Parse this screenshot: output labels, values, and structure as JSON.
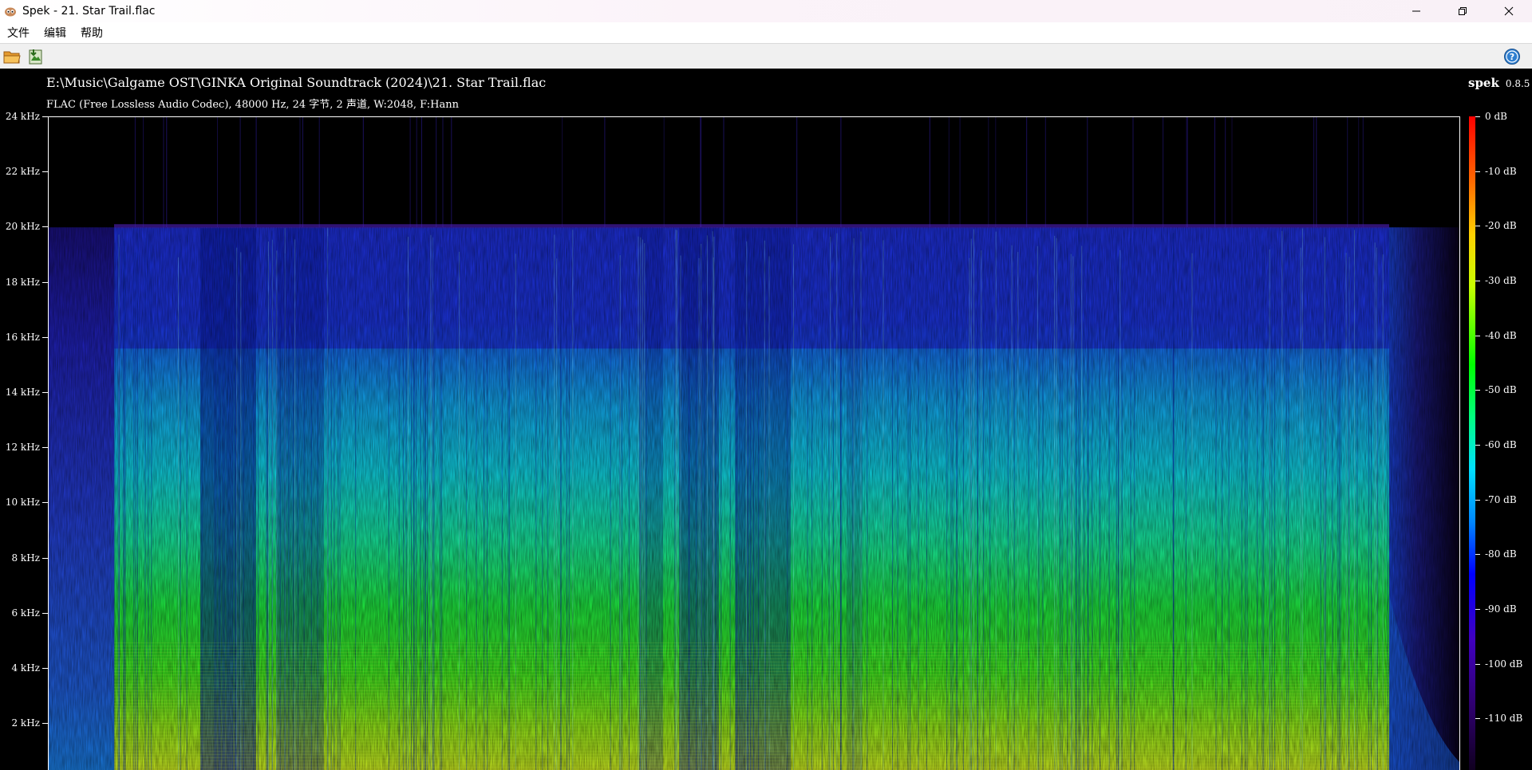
{
  "window": {
    "title": "Spek - 21. Star Trail.flac",
    "controls": {
      "minimize_icon": "minimize-icon",
      "maximize_icon": "restore-icon",
      "close_icon": "close-icon"
    }
  },
  "menu": {
    "items": [
      {
        "label": "文件"
      },
      {
        "label": "编辑"
      },
      {
        "label": "帮助"
      }
    ]
  },
  "toolbar": {
    "open_icon": "folder-open-icon",
    "save_icon": "save-image-icon",
    "help_icon": "help-icon"
  },
  "spectrogram": {
    "file_path": "E:\\Music\\Galgame OST\\GINKA Original Soundtrack (2024)\\21. Star Trail.flac",
    "file_info": "FLAC (Free Lossless Audio Codec), 48000 Hz, 24 字节, 2 声道, W:2048, F:Hann",
    "brand": "spek",
    "version": "0.8.5"
  },
  "chart_data": {
    "type": "heatmap",
    "y_axis": {
      "unit": "kHz",
      "range": [
        0,
        24
      ],
      "ticks": [
        "24 kHz",
        "22 kHz",
        "20 kHz",
        "18 kHz",
        "16 kHz",
        "14 kHz",
        "12 kHz",
        "10 kHz",
        "8 kHz",
        "6 kHz",
        "4 kHz",
        "2 kHz"
      ]
    },
    "color_scale": {
      "unit": "dB",
      "range": [
        -120,
        0
      ],
      "ticks": [
        "0 dB",
        "-10 dB",
        "-20 dB",
        "-30 dB",
        "-40 dB",
        "-50 dB",
        "-60 dB",
        "-70 dB",
        "-80 dB",
        "-90 dB",
        "-100 dB",
        "-110 dB"
      ]
    },
    "lowpass_cutoff_khz": 20,
    "secondary_band_khz": 15.6
  },
  "colors": {
    "background": "#000000",
    "text": "#ffffff",
    "titlebar": "#fbf3f9",
    "toolbar": "#f0f0f0"
  }
}
